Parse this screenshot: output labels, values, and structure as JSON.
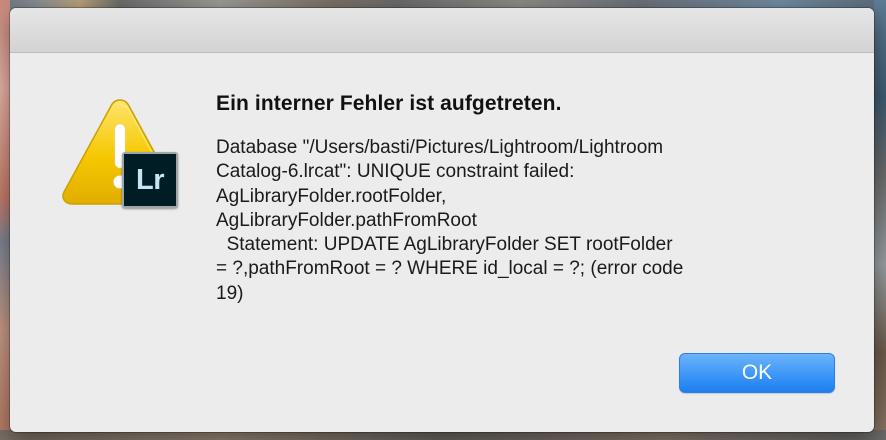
{
  "dialog": {
    "heading": "Ein interner Fehler ist aufgetreten.",
    "message": "Database \"/Users/basti/Pictures/Lightroom/Lightroom\nCatalog-6.lrcat\": UNIQUE constraint failed:\nAgLibraryFolder.rootFolder,\nAgLibraryFolder.pathFromRoot\n  Statement: UPDATE AgLibraryFolder SET rootFolder\n= ?,pathFromRoot = ? WHERE id_local = ?; (error code\n19)",
    "ok_label": "OK",
    "icon": "warning-triangle-icon",
    "app_badge_icon": "lightroom-badge-icon",
    "app_badge_text": "Lr"
  },
  "colors": {
    "accent": "#3d97f7",
    "dialog_bg": "#ececec",
    "warning_yellow": "#f2c200",
    "lr_badge_bg": "#001d26",
    "lr_badge_text": "#c9e4f0"
  }
}
